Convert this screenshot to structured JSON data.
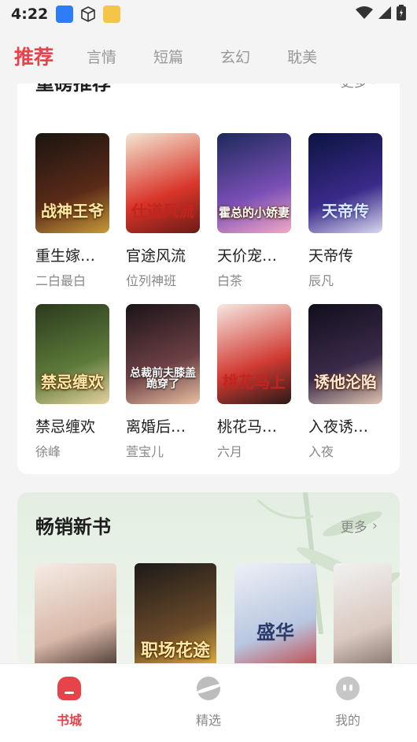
{
  "status_bar": {
    "time": "4:22",
    "icons": [
      "app-blue-icon",
      "box-icon",
      "game-icon"
    ],
    "right_icons": [
      "wifi-icon",
      "signal-icon",
      "battery-icon"
    ]
  },
  "top_tabs": [
    {
      "label": "推荐",
      "active": true
    },
    {
      "label": "言情",
      "active": false
    },
    {
      "label": "短篇",
      "active": false
    },
    {
      "label": "玄幻",
      "active": false
    },
    {
      "label": "耽美",
      "active": false
    }
  ],
  "section_featured": {
    "title": "重磅推荐",
    "more": "更多",
    "books": [
      {
        "title": "重生嫁…",
        "author": "二白最白",
        "cover_text": "战神王爷",
        "colors": [
          "#1a1410",
          "#5a2a18",
          "#c79a3a"
        ]
      },
      {
        "title": "官途风流",
        "author": "位列神班",
        "cover_text": "仕道风流",
        "colors": [
          "#f3e6d2",
          "#d9352a",
          "#6b1b16"
        ]
      },
      {
        "title": "天价宠…",
        "author": "白茶",
        "cover_text": "霍总的小娇妻",
        "colors": [
          "#1d2a5a",
          "#7a4fb6",
          "#f4a9c6"
        ]
      },
      {
        "title": "天帝传",
        "author": "辰凡",
        "cover_text": "天帝传",
        "colors": [
          "#0b1440",
          "#3a2a8a",
          "#d8d8f0"
        ]
      },
      {
        "title": "禁忌缠欢",
        "author": "徐峰",
        "cover_text": "禁忌缠欢",
        "colors": [
          "#2b3a1d",
          "#5d7a3a",
          "#e6d3a0"
        ]
      },
      {
        "title": "离婚后…",
        "author": "萱宝儿",
        "cover_text": "总裁前夫膝盖跪穿了",
        "colors": [
          "#1a1418",
          "#6d4044",
          "#e7c1a1"
        ]
      },
      {
        "title": "桃花马…",
        "author": "六月",
        "cover_text": "桃花马上",
        "colors": [
          "#f6e8e0",
          "#d03a32",
          "#2a1a18"
        ]
      },
      {
        "title": "入夜诱…",
        "author": "入夜",
        "cover_text": "诱他沦陷",
        "colors": [
          "#120e1c",
          "#3a2a4a",
          "#e0c4b0"
        ]
      }
    ]
  },
  "section_bestseller": {
    "title": "畅销新书",
    "more": "更多",
    "covers": [
      {
        "cover_text": "",
        "colors": [
          "#f5ece6",
          "#d8b8a8",
          "#3a2a24"
        ]
      },
      {
        "cover_text": "职场花途",
        "colors": [
          "#1c1a18",
          "#6a4a2a",
          "#f0c040"
        ]
      },
      {
        "cover_text": "盛华",
        "colors": [
          "#eef0f6",
          "#b8c6e0",
          "#c23a3a"
        ]
      },
      {
        "cover_text": "",
        "colors": [
          "#f2f2f2",
          "#d9c9c0",
          "#7a6a64"
        ]
      }
    ]
  },
  "bottom_nav": [
    {
      "label": "书城",
      "icon": "bookstore-icon",
      "active": true
    },
    {
      "label": "精选",
      "icon": "planet-icon",
      "active": false
    },
    {
      "label": "我的",
      "icon": "profile-icon",
      "active": false
    }
  ],
  "colors": {
    "accent": "#e8424a",
    "muted": "#888888",
    "bestseller_bg": "#e3eee2"
  }
}
